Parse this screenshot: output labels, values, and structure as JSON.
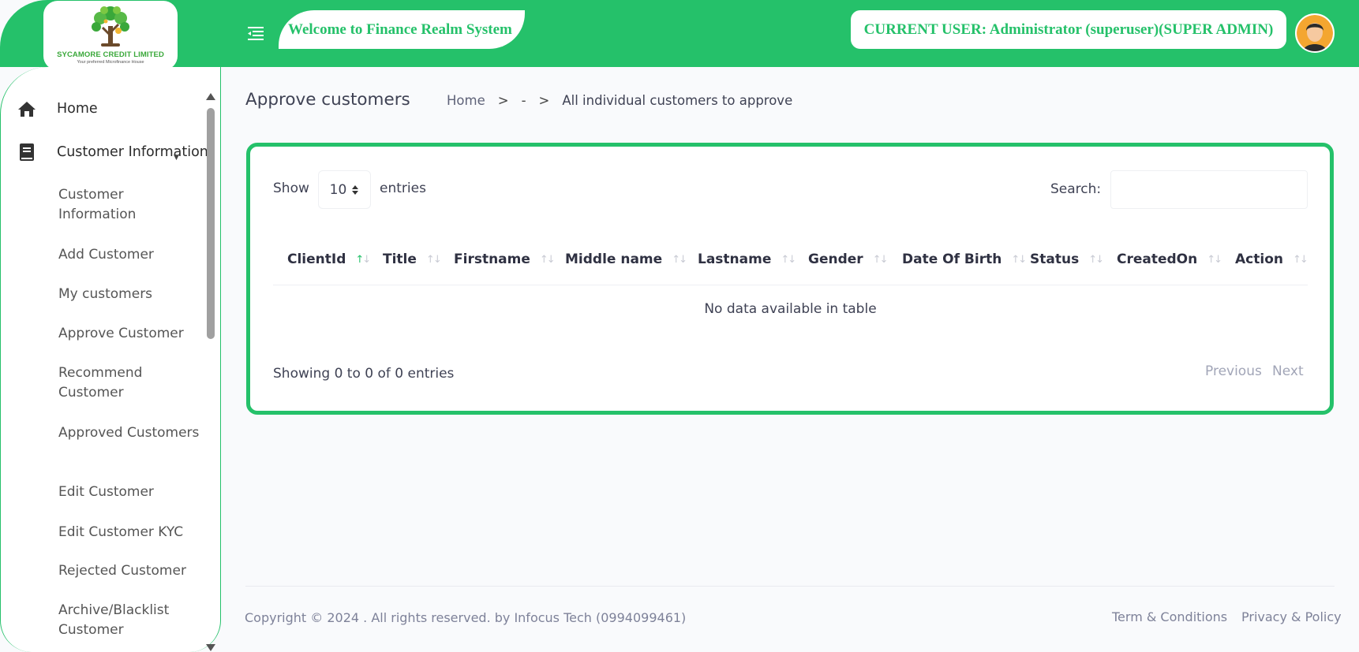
{
  "header": {
    "logo": {
      "name": "SYCAMORE CREDIT LIMITED",
      "tagline": "Your preferred Microfinance House"
    },
    "welcome": "Welcome to Finance Realm System",
    "current_user": "CURRENT USER: Administrator (superuser)(SUPER ADMIN)",
    "menu_icon": "menu-collapse-icon",
    "brand_color": "#25c16a"
  },
  "sidebar": {
    "main": [
      {
        "label": "Home",
        "icon": "home-icon"
      },
      {
        "label": "Customer Information",
        "icon": "book-icon"
      }
    ],
    "sub": [
      "Customer Information",
      "Add Customer",
      "My customers",
      "Approve Customer",
      "Recommend Customer",
      "Approved Customers",
      "Edit Customer",
      "Edit Customer KYC",
      "Rejected Customer",
      "Archive/Blacklist Customer"
    ]
  },
  "page": {
    "title": "Approve customers",
    "breadcrumb": {
      "home": "Home",
      "sep1": ">",
      "middle": "-",
      "sep2": ">",
      "current": "All individual customers to approve"
    }
  },
  "table": {
    "show_label": "Show",
    "length_value": "10",
    "entries_label": "entries",
    "search_label": "Search:",
    "search_value": "",
    "columns": [
      "ClientId",
      "Title",
      "Firstname",
      "Middle name",
      "Lastname",
      "Gender",
      "Date Of Birth",
      "Status",
      "CreatedOn",
      "Action"
    ],
    "empty_message": "No data available in table",
    "info": "Showing 0 to 0 of 0 entries",
    "previous": "Previous",
    "next": "Next"
  },
  "footer": {
    "copyright": "Copyright © 2024 . All rights reserved. by Infocus Tech (0994099461)",
    "terms": "Term & Conditions",
    "privacy": "Privacy & Policy"
  }
}
